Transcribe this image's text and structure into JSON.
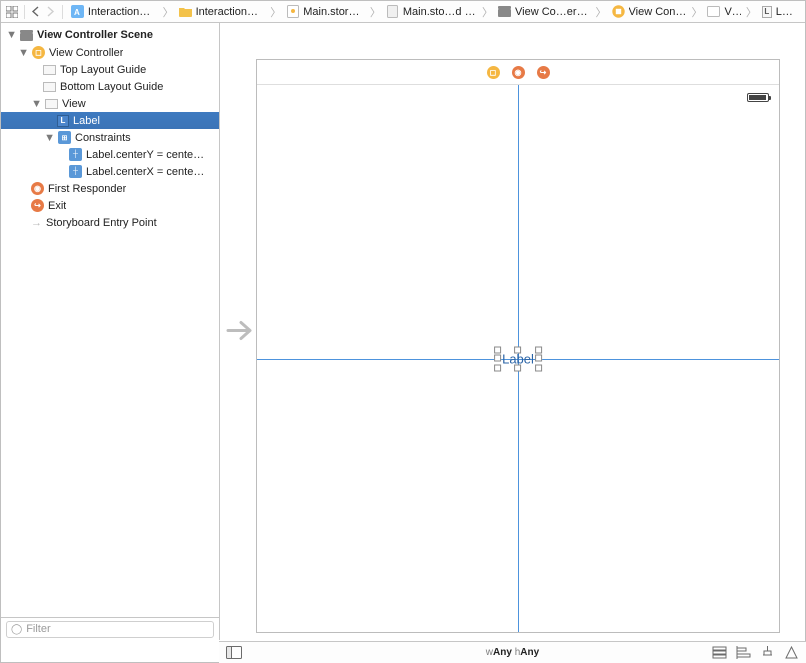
{
  "jumpbar": {
    "items": [
      {
        "label": "InteractionSample",
        "icon": "project"
      },
      {
        "label": "InteractionSample",
        "icon": "folder"
      },
      {
        "label": "Main.storyboard",
        "icon": "storyboard"
      },
      {
        "label": "Main.sto…d (Base)",
        "icon": "file"
      },
      {
        "label": "View Co…er Scene",
        "icon": "scene"
      },
      {
        "label": "View Controller",
        "icon": "viewcontroller"
      },
      {
        "label": "View",
        "icon": "view"
      },
      {
        "label": "Label",
        "icon": "label"
      }
    ]
  },
  "outline": {
    "header": "View Controller Scene",
    "viewController": "View Controller",
    "topGuide": "Top Layout Guide",
    "bottomGuide": "Bottom Layout Guide",
    "view": "View",
    "label": "Label",
    "constraints": "Constraints",
    "c1": "Label.centerY = cente…",
    "c2": "Label.centerX = cente…",
    "firstResponder": "First Responder",
    "exit": "Exit",
    "entry": "Storyboard Entry Point"
  },
  "filter": {
    "placeholder": "Filter"
  },
  "canvas": {
    "labelText": "Label"
  },
  "sizeclass": {
    "wPrefix": "w",
    "w": "Any",
    "hPrefix": "h",
    "h": "Any"
  }
}
